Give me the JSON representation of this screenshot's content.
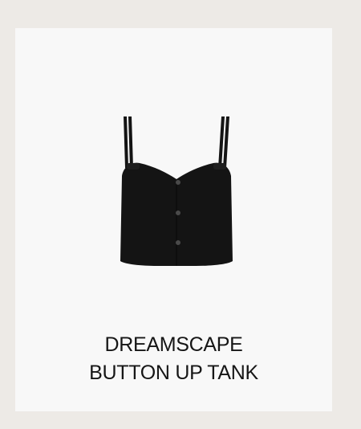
{
  "product": {
    "name_line1": "DREAMSCAPE",
    "name_line2": "BUTTON UP TANK",
    "image_icon": "black-button-up-tank-top-image",
    "garment_color": "#141414",
    "button_color": "#4a4a4a"
  },
  "page": {
    "background": "#edeae6",
    "card_background": "#f8f8f8"
  }
}
